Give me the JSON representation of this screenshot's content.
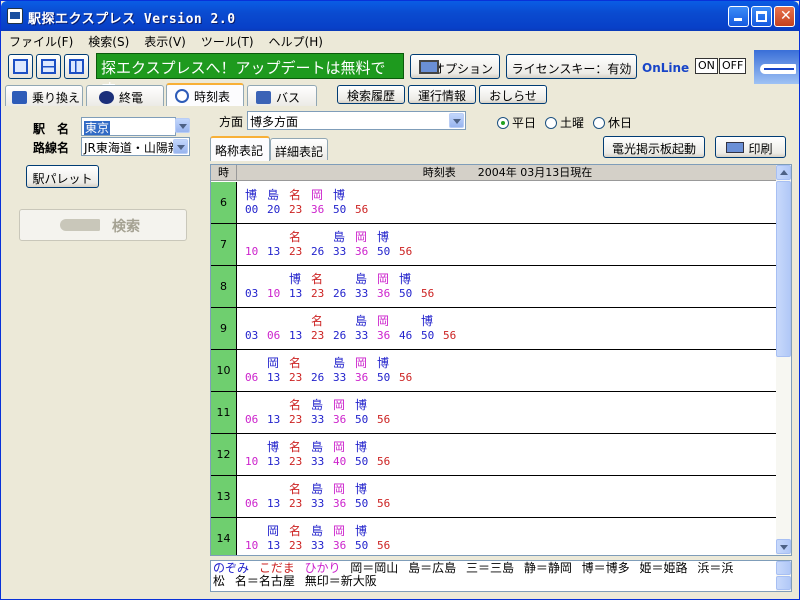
{
  "title": "駅探エクスプレス Version 2.0",
  "menu": [
    "ファイル(F)",
    "検索(S)",
    "表示(V)",
    "ツール(T)",
    "ヘルプ(H)"
  ],
  "banner": "探エクスプレスへ！アップデートは無料です。",
  "toolbar": {
    "option": "オプション",
    "license": "ライセンスキー：有効",
    "online": "OnLine",
    "on": "ON",
    "off": "OFF"
  },
  "tabs": [
    "乗り換え",
    "終電",
    "時刻表",
    "バス"
  ],
  "active_tab": "時刻表",
  "extra_buttons": [
    "検索履歴",
    "運行情報",
    "おしらせ"
  ],
  "left": {
    "station_label": "駅　名",
    "station_value": "東京",
    "line_label": "路線名",
    "line_value": "JR東海道・山陽新",
    "palette_button": "駅パレット",
    "search_button": "検索"
  },
  "right": {
    "direction_label": "方面",
    "direction_value": "博多方面",
    "radios": [
      {
        "label": "平日",
        "checked": true
      },
      {
        "label": "土曜",
        "checked": false
      },
      {
        "label": "休日",
        "checked": false
      }
    ],
    "subtabs": [
      "略称表記",
      "詳細表記"
    ],
    "board_button": "電光掲示板起動",
    "print_button": "印刷",
    "grid_header_hour": "時",
    "grid_header_title": "時刻表　　2004年 03月13日現在"
  },
  "colors": {
    "nozomi": "#2222cc",
    "kodama": "#cc2222",
    "hikari": "#cc22cc",
    "hour_bg": "#6fcf6f",
    "banner": "#1e9a1e"
  },
  "timetable": [
    {
      "hour": "6",
      "trains": [
        [
          "博",
          "00",
          "n"
        ],
        [
          "島",
          "20",
          "n"
        ],
        [
          "名",
          "23",
          "k"
        ],
        [
          "岡",
          "36",
          "h"
        ],
        [
          "博",
          "50",
          "n"
        ],
        [
          "",
          "56",
          "k"
        ]
      ]
    },
    {
      "hour": "7",
      "trains": [
        [
          "",
          "10",
          "h"
        ],
        [
          "",
          "13",
          "n"
        ],
        [
          "名",
          "23",
          "k"
        ],
        [
          "",
          "26",
          "n"
        ],
        [
          "島",
          "33",
          "n"
        ],
        [
          "岡",
          "36",
          "h"
        ],
        [
          "博",
          "50",
          "n"
        ],
        [
          "",
          "56",
          "k"
        ]
      ]
    },
    {
      "hour": "8",
      "trains": [
        [
          "",
          "03",
          "n"
        ],
        [
          "",
          "10",
          "h"
        ],
        [
          "博",
          "13",
          "n"
        ],
        [
          "名",
          "23",
          "k"
        ],
        [
          "",
          "26",
          "n"
        ],
        [
          "島",
          "33",
          "n"
        ],
        [
          "岡",
          "36",
          "h"
        ],
        [
          "博",
          "50",
          "n"
        ],
        [
          "",
          "56",
          "k"
        ]
      ]
    },
    {
      "hour": "9",
      "trains": [
        [
          "",
          "03",
          "n"
        ],
        [
          "",
          "06",
          "h"
        ],
        [
          "",
          "13",
          "n"
        ],
        [
          "名",
          "23",
          "k"
        ],
        [
          "",
          "26",
          "n"
        ],
        [
          "島",
          "33",
          "n"
        ],
        [
          "岡",
          "36",
          "h"
        ],
        [
          "",
          "46",
          "n"
        ],
        [
          "博",
          "50",
          "n"
        ],
        [
          "",
          "56",
          "k"
        ]
      ]
    },
    {
      "hour": "10",
      "trains": [
        [
          "",
          "06",
          "h"
        ],
        [
          "岡",
          "13",
          "n"
        ],
        [
          "名",
          "23",
          "k"
        ],
        [
          "",
          "26",
          "n"
        ],
        [
          "島",
          "33",
          "n"
        ],
        [
          "岡",
          "36",
          "h"
        ],
        [
          "博",
          "50",
          "n"
        ],
        [
          "",
          "56",
          "k"
        ]
      ]
    },
    {
      "hour": "11",
      "trains": [
        [
          "",
          "06",
          "h"
        ],
        [
          "",
          "13",
          "n"
        ],
        [
          "名",
          "23",
          "k"
        ],
        [
          "島",
          "33",
          "n"
        ],
        [
          "岡",
          "36",
          "h"
        ],
        [
          "博",
          "50",
          "n"
        ],
        [
          "",
          "56",
          "k"
        ]
      ]
    },
    {
      "hour": "12",
      "trains": [
        [
          "",
          "10",
          "h"
        ],
        [
          "博",
          "13",
          "n"
        ],
        [
          "名",
          "23",
          "k"
        ],
        [
          "島",
          "33",
          "n"
        ],
        [
          "岡",
          "40",
          "h"
        ],
        [
          "博",
          "50",
          "n"
        ],
        [
          "",
          "56",
          "k"
        ]
      ]
    },
    {
      "hour": "13",
      "trains": [
        [
          "",
          "06",
          "h"
        ],
        [
          "",
          "13",
          "n"
        ],
        [
          "名",
          "23",
          "k"
        ],
        [
          "島",
          "33",
          "n"
        ],
        [
          "岡",
          "36",
          "h"
        ],
        [
          "博",
          "50",
          "n"
        ],
        [
          "",
          "56",
          "k"
        ]
      ]
    },
    {
      "hour": "14",
      "trains": [
        [
          "",
          "10",
          "h"
        ],
        [
          "岡",
          "13",
          "n"
        ],
        [
          "名",
          "23",
          "k"
        ],
        [
          "島",
          "33",
          "n"
        ],
        [
          "岡",
          "36",
          "h"
        ],
        [
          "博",
          "50",
          "n"
        ],
        [
          "",
          "56",
          "k"
        ]
      ]
    }
  ],
  "legend": {
    "kinds": [
      {
        "label": "のぞみ",
        "c": "n"
      },
      {
        "label": "こだま",
        "c": "k"
      },
      {
        "label": "ひかり",
        "c": "h"
      }
    ],
    "abbrevs": [
      "岡＝岡山",
      "島＝広島",
      "三＝三島",
      "静＝静岡",
      "博＝博多",
      "姫＝姫路",
      "浜＝浜",
      "松",
      "名＝名古屋",
      "無印＝新大阪"
    ]
  }
}
